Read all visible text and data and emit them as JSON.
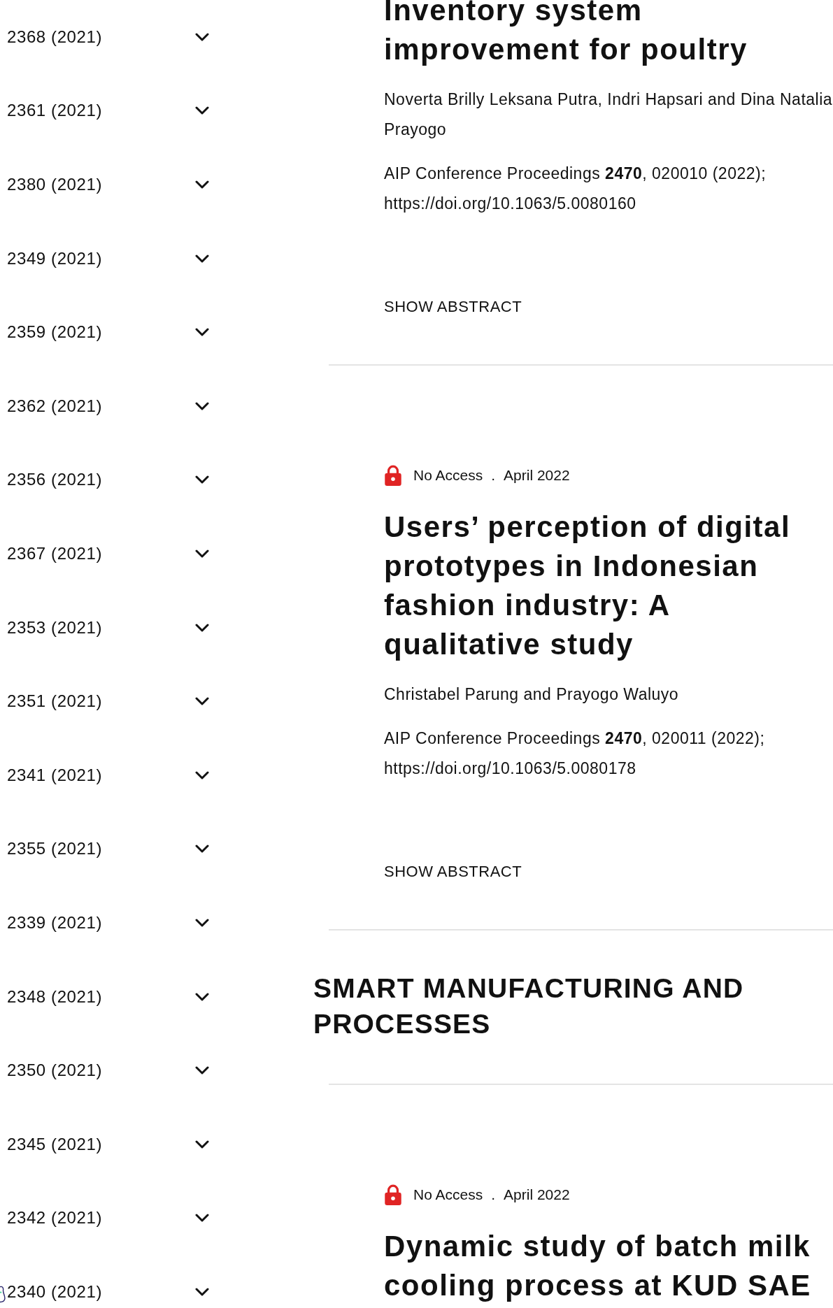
{
  "sidebar": {
    "items": [
      {
        "label": "2368 (2021)",
        "expanded": false
      },
      {
        "label": "2361 (2021)",
        "expanded": false
      },
      {
        "label": "2380 (2021)",
        "expanded": false
      },
      {
        "label": "2349 (2021)",
        "expanded": false
      },
      {
        "label": "2359 (2021)",
        "expanded": false
      },
      {
        "label": "2362 (2021)",
        "expanded": false
      },
      {
        "label": "2356 (2021)",
        "expanded": false
      },
      {
        "label": "2367 (2021)",
        "expanded": false
      },
      {
        "label": "2353 (2021)",
        "expanded": false
      },
      {
        "label": "2351 (2021)",
        "expanded": false
      },
      {
        "label": "2341 (2021)",
        "expanded": false
      },
      {
        "label": "2355 (2021)",
        "expanded": false
      },
      {
        "label": "2339 (2021)",
        "expanded": false
      },
      {
        "label": "2348 (2021)",
        "expanded": false
      },
      {
        "label": "2350 (2021)",
        "expanded": false
      },
      {
        "label": "2345 (2021)",
        "expanded": false
      },
      {
        "label": "2342 (2021)",
        "expanded": false
      },
      {
        "label": "2340 (2021)",
        "expanded": false
      }
    ]
  },
  "content": [
    {
      "kind": "article",
      "title": "Inventory system improvement for poultry",
      "authors": "Noverta Brilly Leksana Putra, Indri Hapsari and Dina Natalia Prayogo",
      "citation": "AIP Conference Proceedings **2470**, 020010 (2022);",
      "doi": "https://doi.org/10.1063/5.0080160",
      "abstract_button": "SHOW ABSTRACT"
    },
    {
      "kind": "article",
      "access": "No Access",
      "separator": ".",
      "date": "April 2022",
      "title": "Users’ perception of digital prototypes in Indonesian fashion industry: A qualitative study",
      "authors": "Christabel Parung and Prayogo Waluyo",
      "citation": "AIP Conference Proceedings **2470**, 020011 (2022);",
      "doi": "https://doi.org/10.1063/5.0080178",
      "abstract_button": "SHOW ABSTRACT"
    },
    {
      "kind": "section_heading",
      "title": "SMART MANUFACTURING AND PROCESSES"
    },
    {
      "kind": "article",
      "access": "No Access",
      "separator": ".",
      "date": "April 2022",
      "title": "Dynamic study of batch milk cooling process at KUD SAE"
    }
  ]
}
